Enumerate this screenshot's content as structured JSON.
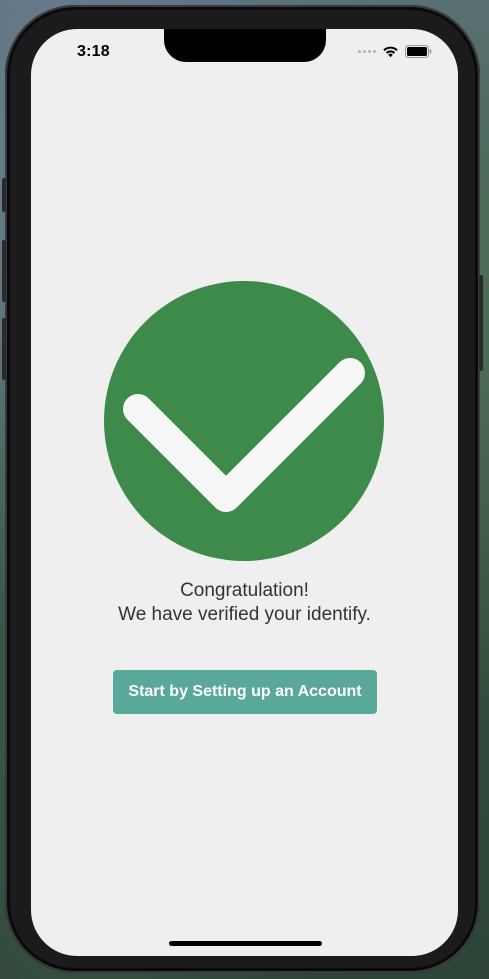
{
  "status_bar": {
    "time": "3:18",
    "icons": [
      "cellular-signal-icon",
      "wifi-icon",
      "battery-icon"
    ]
  },
  "success": {
    "icon": "checkmark-icon",
    "circle_color": "#3d8a4a",
    "line1": "Congratulation!",
    "line2": "We have verified your identify."
  },
  "cta": {
    "label": "Start by Setting up an Account",
    "color": "#5aa899"
  }
}
